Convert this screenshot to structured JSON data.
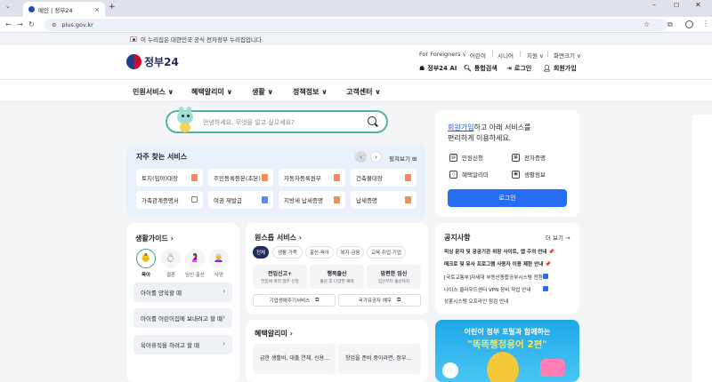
{
  "browser": {
    "tab_title": "메인 | 정부24",
    "tab_close": "×",
    "new_tab": "+",
    "url": "plus.gov.kr"
  },
  "gov_banner": {
    "text": "이 누리집은 대한민국 공식 전자정부 누리집입니다."
  },
  "header": {
    "logo_text": "정부",
    "logo_num": "24",
    "util": [
      "For Foreigners ∨",
      "어린이",
      "시니어",
      "지원 ∨",
      "화면크기 ∨"
    ],
    "buttons": [
      "정부24 AI",
      "통합검색",
      "로그인",
      "회원가입"
    ]
  },
  "gnb": {
    "items": [
      "민원서비스 ∨",
      "혜택알리미 ∨",
      "생활 ∨",
      "정책정보 ∨",
      "고객센터 ∨"
    ]
  },
  "search": {
    "placeholder": "안녕하세요. 무엇을 알고 싶으세요?"
  },
  "favorites": {
    "title": "자주 찾는 서비스",
    "all_label": "펼쳐보기 ⊞",
    "prev": "‹",
    "next": "›",
    "items": [
      "토지(임야)대장",
      "주민등록등본(초본)",
      "자동차등록원부",
      "건축물대장",
      "가족관계증명서",
      "여권 재발급",
      "지방세 납세증명",
      "납세증명"
    ]
  },
  "login_card": {
    "link": "회원가입",
    "line1_rest": "하고 아래 서비스를",
    "line2": "편리하게 이용하세요.",
    "items": [
      "민원신청",
      "전자증명",
      "혜택알리미",
      "생활정보"
    ],
    "button": "로그인"
  },
  "life_guide": {
    "title": "생활가이드 ›",
    "icons": [
      {
        "glyph": "👶",
        "label": "육아"
      },
      {
        "glyph": "💍",
        "label": "결혼"
      },
      {
        "glyph": "🤰",
        "label": "임신·출산"
      },
      {
        "glyph": "👩‍🦳",
        "label": "사망"
      }
    ],
    "rows": [
      "아이를 양육할 때",
      "아이를 어린이집에 보내려고 할 때",
      "육아휴직을 하려고 할 때"
    ],
    "arrow": "›"
  },
  "onestop": {
    "title": "원스톱 서비스 ›",
    "tabs": [
      "전체",
      "생활·가족",
      "출산·육아",
      "복지·금융",
      "교육·취업·기업"
    ],
    "boxes": [
      {
        "title": "전입신고+",
        "sub": "전입에 여러 업무 신청"
      },
      {
        "title": "행복출산",
        "sub": "출산 후 다양한 혜택"
      },
      {
        "title": "맘편한 임신",
        "sub": "임신부터 출산까지"
      }
    ],
    "links": [
      "기업생애주기서비스",
      "국가유공자 예우"
    ],
    "ext": "⧉"
  },
  "benefit": {
    "title": "혜택알리미 ›",
    "items": [
      "급한 생활비, 대출 연체, 신용...",
      "창업을 준비 중이라면, 정부..."
    ]
  },
  "notice": {
    "title": "공지사항",
    "more": "더 보기 →",
    "items": [
      "피싱 문자 및 공공기관 위장 사이트, 앱 주의 안내 📌",
      "매크로 및 유사 프로그램 사용자 이용 제한 안내 📌",
      "[국토교통부]자세대 부동산종합공부시스템 전환...",
      "나이스 클라우드센터 VPN 장비 작업 안내",
      "상훈시스템 오프라인 점검 안내"
    ]
  },
  "promo": {
    "line1": "어린이 정부 포털과 함께하는",
    "line2": "\"똑똑행정용어 2편\""
  },
  "colors": {
    "accent": "#256ef4",
    "navy": "#1d2c5c",
    "search_border": "#4fb7a0",
    "fav_bg": "#e9f1fb",
    "page_bg": "#f4f5f7"
  }
}
